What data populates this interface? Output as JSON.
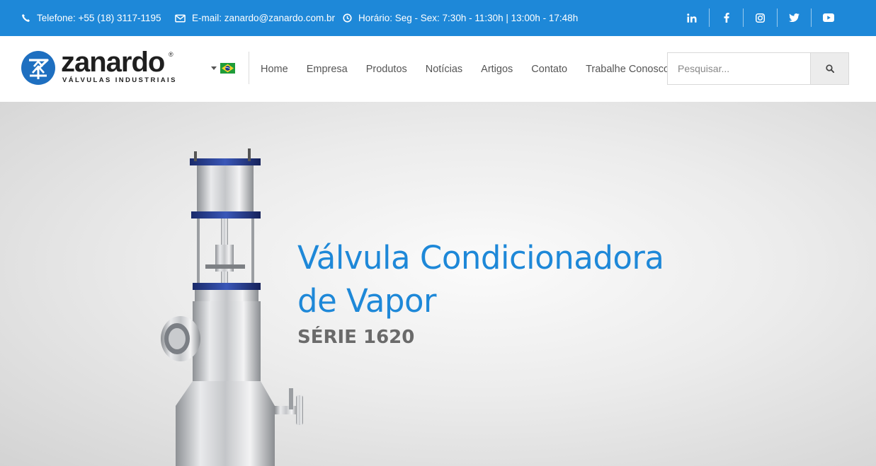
{
  "topbar": {
    "phone": "Telefone: +55 (18) 3117-1195",
    "email": "E-mail: zanardo@zanardo.com.br",
    "hours": "Horário: Seg - Sex: 7:30h - 11:30h | 13:00h - 17:48h",
    "socials": [
      "linkedin-icon",
      "facebook-icon",
      "instagram-icon",
      "twitter-icon",
      "youtube-icon"
    ],
    "background_color": "#1e88d8"
  },
  "logo": {
    "name": "zanardo",
    "tagline": "VÁLVULAS INDUSTRIAIS",
    "registered": "®"
  },
  "language": {
    "selected": "brazil-flag-icon"
  },
  "nav": {
    "items": [
      "Home",
      "Empresa",
      "Produtos",
      "Notícias",
      "Artigos",
      "Contato",
      "Trabalhe Conosco"
    ]
  },
  "search": {
    "placeholder": "Pesquisar...",
    "icon": "search-icon"
  },
  "hero": {
    "title_line1": "Válvula Condicionadora",
    "title_line2": "de Vapor",
    "series": "SÉRIE 1620",
    "accent_color": "#1e88d8"
  }
}
